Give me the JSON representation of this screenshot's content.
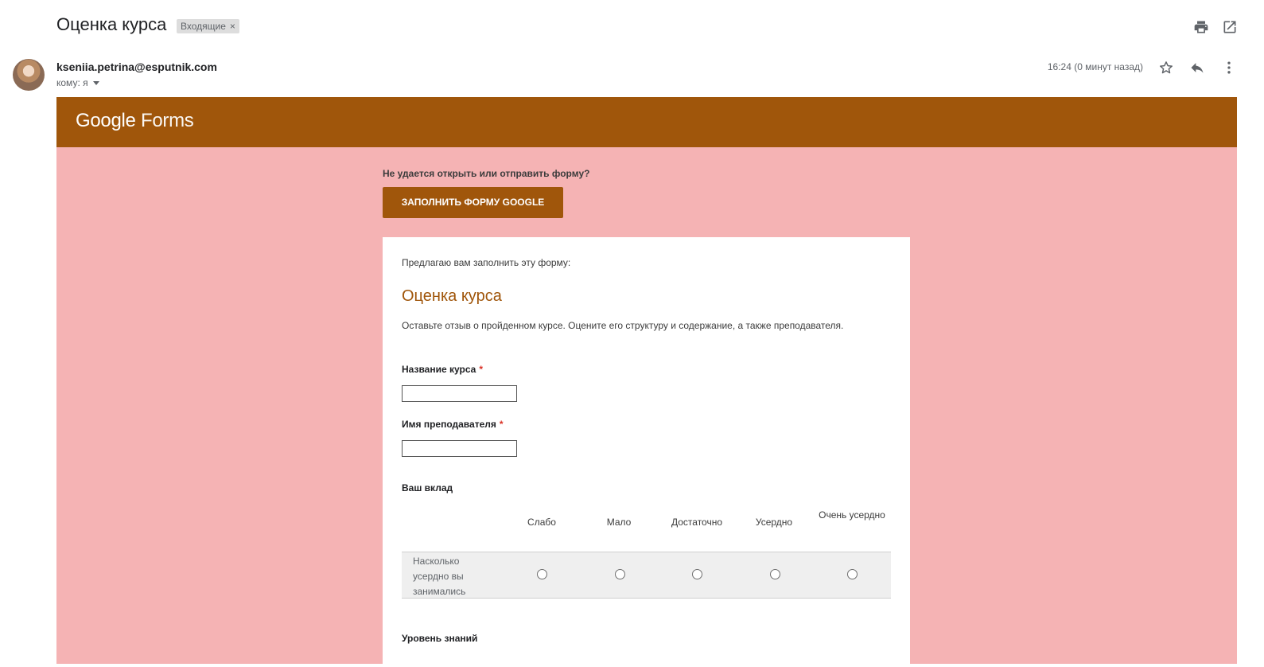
{
  "email": {
    "subject": "Оценка курса",
    "label": "Входящие",
    "label_remove": "×",
    "sender": "kseniia.petrina@esputnik.com",
    "to_text": "кому: я",
    "time": "16:24 (0 минут назад)",
    "icons": [
      "print-icon",
      "open-new-window-icon",
      "star-icon",
      "reply-icon",
      "more-vert-icon"
    ]
  },
  "forms": {
    "logo_google": "Google",
    "logo_forms": "Forms",
    "trouble_text": "Не удается открыть или отправить форму?",
    "fill_button": "ЗАПОЛНИТЬ ФОРМУ GOOGLE",
    "intro": "Предлагаю вам заполнить эту форму:",
    "title": "Оценка курса",
    "description": "Оставьте отзыв о пройденном курсе. Оцените его структуру и содержание, а также преподавателя.",
    "questions": {
      "course_name": {
        "label": "Название курса",
        "required": "*",
        "value": ""
      },
      "teacher_name": {
        "label": "Имя преподавателя",
        "required": "*",
        "value": ""
      },
      "contribution": {
        "label": "Ваш вклад",
        "columns": [
          "Слабо",
          "Мало",
          "Достаточно",
          "Усердно",
          "Очень усердно"
        ],
        "rows": [
          {
            "label": "Насколько усердно вы занимались",
            "selected": null
          }
        ]
      },
      "knowledge": {
        "label": "Уровень знаний"
      }
    }
  },
  "colors": {
    "header_brown": "#a0560b",
    "pink_background": "#f5b3b4",
    "title_brown": "#a0560b",
    "required_red": "#d93025"
  }
}
